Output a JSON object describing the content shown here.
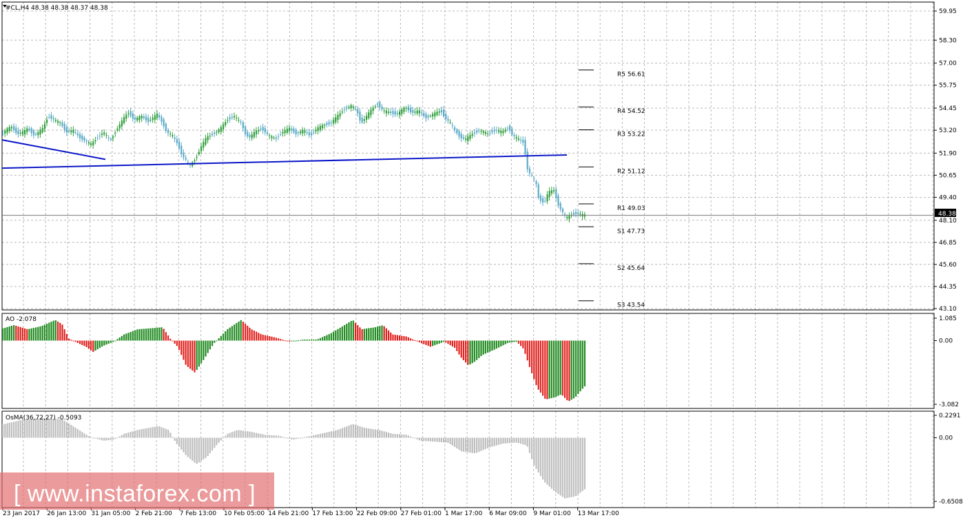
{
  "watermark": "[ www.instaforex.com ]",
  "colors": {
    "bull": "#2e9e3a",
    "bear": "#5aa9c7",
    "ao_up": "#1f8a1f",
    "ao_down": "#e0201c",
    "osma": "#bdbdbd",
    "trend": "#0a16c8"
  },
  "chart_data": [
    {
      "type": "candlestick",
      "title": "#CL,H4  48.38 48.38 48.37 48.38",
      "ylim": [
        43.1,
        59.95
      ],
      "y_ticks": [
        "59.95",
        "58.30",
        "57.00",
        "55.75",
        "54.45",
        "53.20",
        "51.90",
        "50.65",
        "49.40",
        "48.10",
        "46.85",
        "45.60",
        "44.35",
        "43.10"
      ],
      "x_ticks": [
        "23 Jan 2017",
        "26 Jan 13:00",
        "31 Jan 05:00",
        "2 Feb 21:00",
        "7 Feb 13:00",
        "10 Feb 05:00",
        "14 Feb 21:00",
        "17 Feb 13:00",
        "22 Feb 09:00",
        "27 Feb 01:00",
        "1 Mar 17:00",
        "6 Mar 09:00",
        "9 Mar 01:00",
        "13 Mar 17:00"
      ],
      "current_price": "48.38",
      "close_path": [
        [
          0,
          52.9
        ],
        [
          8,
          53.2
        ],
        [
          16,
          53.4
        ],
        [
          25,
          53.0
        ],
        [
          34,
          53.1
        ],
        [
          40,
          53.3
        ],
        [
          50,
          52.9
        ],
        [
          62,
          53.3
        ],
        [
          70,
          54.0
        ],
        [
          78,
          53.8
        ],
        [
          88,
          53.6
        ],
        [
          96,
          53.1
        ],
        [
          106,
          53.2
        ],
        [
          115,
          52.8
        ],
        [
          124,
          52.6
        ],
        [
          132,
          52.4
        ],
        [
          142,
          52.8
        ],
        [
          150,
          53.1
        ],
        [
          160,
          52.6
        ],
        [
          170,
          53.3
        ],
        [
          180,
          53.9
        ],
        [
          186,
          54.2
        ],
        [
          195,
          53.8
        ],
        [
          205,
          54.0
        ],
        [
          215,
          53.7
        ],
        [
          228,
          54.1
        ],
        [
          236,
          53.6
        ],
        [
          242,
          53.1
        ],
        [
          250,
          52.9
        ],
        [
          258,
          52.4
        ],
        [
          264,
          51.8
        ],
        [
          270,
          51.5
        ],
        [
          276,
          51.2
        ],
        [
          284,
          51.6
        ],
        [
          292,
          52.3
        ],
        [
          300,
          52.8
        ],
        [
          310,
          53.0
        ],
        [
          320,
          53.3
        ],
        [
          330,
          53.8
        ],
        [
          340,
          54.0
        ],
        [
          350,
          53.6
        ],
        [
          356,
          53.0
        ],
        [
          362,
          52.8
        ],
        [
          370,
          53.1
        ],
        [
          380,
          53.3
        ],
        [
          390,
          52.9
        ],
        [
          400,
          52.7
        ],
        [
          410,
          53.1
        ],
        [
          420,
          53.3
        ],
        [
          430,
          53.0
        ],
        [
          440,
          53.2
        ],
        [
          450,
          52.9
        ],
        [
          460,
          53.3
        ],
        [
          470,
          53.5
        ],
        [
          480,
          53.6
        ],
        [
          490,
          54.0
        ],
        [
          500,
          54.4
        ],
        [
          510,
          54.6
        ],
        [
          518,
          54.3
        ],
        [
          524,
          53.6
        ],
        [
          532,
          54.0
        ],
        [
          540,
          54.4
        ],
        [
          548,
          54.7
        ],
        [
          556,
          54.3
        ],
        [
          566,
          54.2
        ],
        [
          576,
          54.1
        ],
        [
          588,
          54.5
        ],
        [
          598,
          54.2
        ],
        [
          608,
          54.3
        ],
        [
          618,
          53.9
        ],
        [
          628,
          54.1
        ],
        [
          640,
          54.3
        ],
        [
          646,
          53.9
        ],
        [
          654,
          53.6
        ],
        [
          660,
          53.2
        ],
        [
          668,
          52.8
        ],
        [
          676,
          52.7
        ],
        [
          686,
          53.0
        ],
        [
          696,
          53.2
        ],
        [
          708,
          53.0
        ],
        [
          718,
          53.2
        ],
        [
          730,
          53.1
        ],
        [
          738,
          53.4
        ],
        [
          744,
          52.9
        ],
        [
          752,
          52.7
        ],
        [
          760,
          52.5
        ],
        [
          764,
          51.5
        ],
        [
          766,
          50.9
        ],
        [
          772,
          50.6
        ],
        [
          778,
          50.2
        ],
        [
          782,
          49.3
        ],
        [
          790,
          49.1
        ],
        [
          796,
          49.7
        ],
        [
          804,
          49.8
        ],
        [
          810,
          49.0
        ],
        [
          816,
          48.6
        ],
        [
          822,
          48.2
        ],
        [
          828,
          48.4
        ],
        [
          836,
          48.5
        ],
        [
          846,
          48.4
        ],
        [
          852,
          48.4
        ]
      ],
      "trend_lines": [
        {
          "from": [
            0,
            52.65
          ],
          "to": [
            150,
            51.55
          ]
        },
        {
          "from": [
            0,
            51.05
          ],
          "to": [
            820,
            51.8
          ]
        }
      ],
      "pivots": [
        {
          "label": "R5",
          "value": "56.61",
          "y": 56.61
        },
        {
          "label": "R4",
          "value": "54.52",
          "y": 54.52
        },
        {
          "label": "R3",
          "value": "53.22",
          "y": 53.22
        },
        {
          "label": "R2",
          "value": "51.12",
          "y": 51.12
        },
        {
          "label": "R1",
          "value": "49.03",
          "y": 49.03
        },
        {
          "label": "S1",
          "value": "47.73",
          "y": 47.73
        },
        {
          "label": "S2",
          "value": "45.64",
          "y": 45.64
        },
        {
          "label": "S3",
          "value": "43.54",
          "y": 43.54
        }
      ]
    },
    {
      "type": "bar",
      "title": "AO -2.078",
      "ylim": [
        -3.082,
        1.085
      ],
      "y_ticks": [
        "1.085",
        "0.00",
        "-3.082"
      ],
      "points": [
        [
          0,
          0.55
        ],
        [
          20,
          0.75
        ],
        [
          40,
          0.55
        ],
        [
          60,
          0.7
        ],
        [
          80,
          1.0
        ],
        [
          90,
          0.8
        ],
        [
          100,
          0.1
        ],
        [
          115,
          -0.15
        ],
        [
          125,
          -0.3
        ],
        [
          135,
          -0.55
        ],
        [
          150,
          -0.25
        ],
        [
          165,
          -0.05
        ],
        [
          180,
          0.3
        ],
        [
          200,
          0.55
        ],
        [
          220,
          0.6
        ],
        [
          236,
          0.65
        ],
        [
          248,
          0.05
        ],
        [
          258,
          -0.3
        ],
        [
          270,
          -1.2
        ],
        [
          283,
          -1.55
        ],
        [
          296,
          -0.9
        ],
        [
          310,
          -0.15
        ],
        [
          330,
          0.55
        ],
        [
          350,
          1.0
        ],
        [
          365,
          0.55
        ],
        [
          380,
          0.3
        ],
        [
          400,
          0.15
        ],
        [
          420,
          -0.05
        ],
        [
          440,
          0.05
        ],
        [
          460,
          0.05
        ],
        [
          480,
          0.35
        ],
        [
          500,
          0.75
        ],
        [
          512,
          1.0
        ],
        [
          525,
          0.55
        ],
        [
          545,
          0.65
        ],
        [
          556,
          0.75
        ],
        [
          570,
          0.3
        ],
        [
          590,
          0.2
        ],
        [
          610,
          -0.1
        ],
        [
          625,
          -0.3
        ],
        [
          645,
          -0.05
        ],
        [
          660,
          -0.35
        ],
        [
          670,
          -0.85
        ],
        [
          680,
          -1.2
        ],
        [
          690,
          -1.0
        ],
        [
          700,
          -0.7
        ],
        [
          720,
          -0.4
        ],
        [
          738,
          -0.1
        ],
        [
          750,
          -0.05
        ],
        [
          760,
          -0.4
        ],
        [
          770,
          -1.4
        ],
        [
          780,
          -2.3
        ],
        [
          792,
          -2.85
        ],
        [
          805,
          -2.75
        ],
        [
          815,
          -2.6
        ],
        [
          825,
          -2.95
        ],
        [
          835,
          -2.75
        ],
        [
          845,
          -2.35
        ],
        [
          852,
          -2.1
        ]
      ]
    },
    {
      "type": "bar",
      "title": "OsMA(36,72,27) -0.5093",
      "ylim": [
        -0.6508,
        0.2291
      ],
      "y_ticks": [
        "0.2291",
        "0.00",
        "-0.6508"
      ],
      "points": [
        [
          0,
          0.13
        ],
        [
          30,
          0.18
        ],
        [
          60,
          0.2
        ],
        [
          90,
          0.19
        ],
        [
          110,
          0.1
        ],
        [
          130,
          0.01
        ],
        [
          150,
          -0.03
        ],
        [
          165,
          -0.02
        ],
        [
          180,
          0.04
        ],
        [
          200,
          0.08
        ],
        [
          230,
          0.12
        ],
        [
          245,
          0.08
        ],
        [
          255,
          -0.05
        ],
        [
          270,
          -0.18
        ],
        [
          285,
          -0.27
        ],
        [
          300,
          -0.2
        ],
        [
          315,
          -0.07
        ],
        [
          330,
          0.04
        ],
        [
          345,
          0.08
        ],
        [
          365,
          0.06
        ],
        [
          385,
          0.03
        ],
        [
          405,
          0.02
        ],
        [
          425,
          -0.02
        ],
        [
          445,
          0.01
        ],
        [
          465,
          0.04
        ],
        [
          490,
          0.08
        ],
        [
          512,
          0.14
        ],
        [
          530,
          0.1
        ],
        [
          550,
          0.08
        ],
        [
          570,
          0.04
        ],
        [
          590,
          0.03
        ],
        [
          610,
          -0.03
        ],
        [
          630,
          -0.04
        ],
        [
          650,
          -0.05
        ],
        [
          670,
          -0.14
        ],
        [
          690,
          -0.16
        ],
        [
          710,
          -0.1
        ],
        [
          730,
          -0.06
        ],
        [
          750,
          -0.05
        ],
        [
          765,
          -0.08
        ],
        [
          775,
          -0.28
        ],
        [
          790,
          -0.45
        ],
        [
          805,
          -0.55
        ],
        [
          820,
          -0.62
        ],
        [
          835,
          -0.6
        ],
        [
          852,
          -0.51
        ]
      ]
    }
  ]
}
